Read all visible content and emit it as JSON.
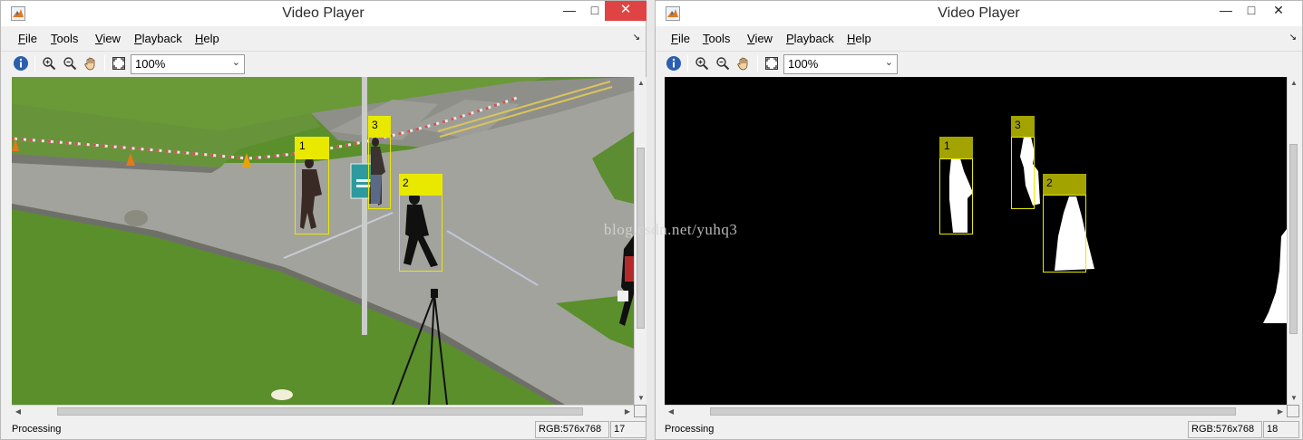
{
  "windows": [
    {
      "title": "Video Player",
      "menu": [
        "File",
        "Tools",
        "View",
        "Playback",
        "Help"
      ],
      "zoom": "100%",
      "status": "Processing",
      "resolution": "RGB:576x768",
      "frame": "17",
      "tracks": [
        {
          "label": "1"
        },
        {
          "label": "3"
        },
        {
          "label": "2"
        }
      ]
    },
    {
      "title": "Video Player",
      "menu": [
        "File",
        "Tools",
        "View",
        "Playback",
        "Help"
      ],
      "zoom": "100%",
      "status": "Processing",
      "resolution": "RGB:576x768",
      "frame": "18",
      "watermark": "blog.csdn.net/yuhq3",
      "tracks": [
        {
          "label": "1"
        },
        {
          "label": "3"
        },
        {
          "label": "2"
        }
      ]
    }
  ],
  "colors": {
    "close_button": "#e04343",
    "track_box": "#e9e900",
    "track_label_mask": "#a3a300",
    "grass": "#5a8f2c",
    "road": "#9a9a94"
  },
  "icons": {
    "app": "matlab-icon",
    "info": "info-icon",
    "zoom_in": "zoom-in-icon",
    "zoom_out": "zoom-out-icon",
    "pan": "pan-hand-icon",
    "fit": "fit-to-window-icon"
  }
}
